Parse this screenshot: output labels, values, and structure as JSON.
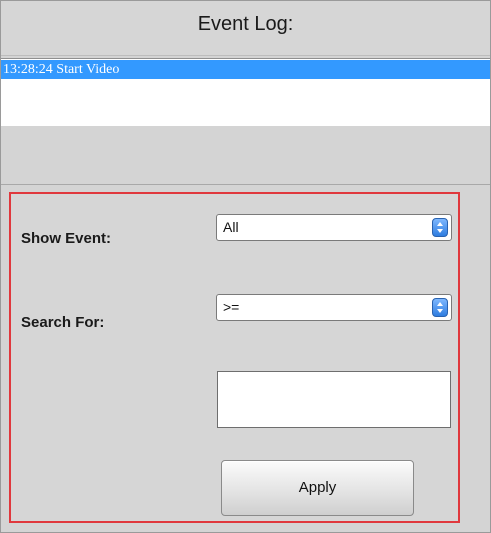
{
  "event_log": {
    "title": "Event Log:",
    "entries": [
      {
        "text": "13:28:24 Start Video",
        "selected": true
      }
    ]
  },
  "filter": {
    "show_event_label": "Show Event:",
    "show_event_value": "All",
    "search_for_label": "Search For:",
    "search_for_value": ">=",
    "search_text_value": "",
    "apply_label": "Apply"
  },
  "colors": {
    "selection": "#3399ff",
    "highlight_border": "#e0383d",
    "panel_background": "#d4d4d4"
  }
}
